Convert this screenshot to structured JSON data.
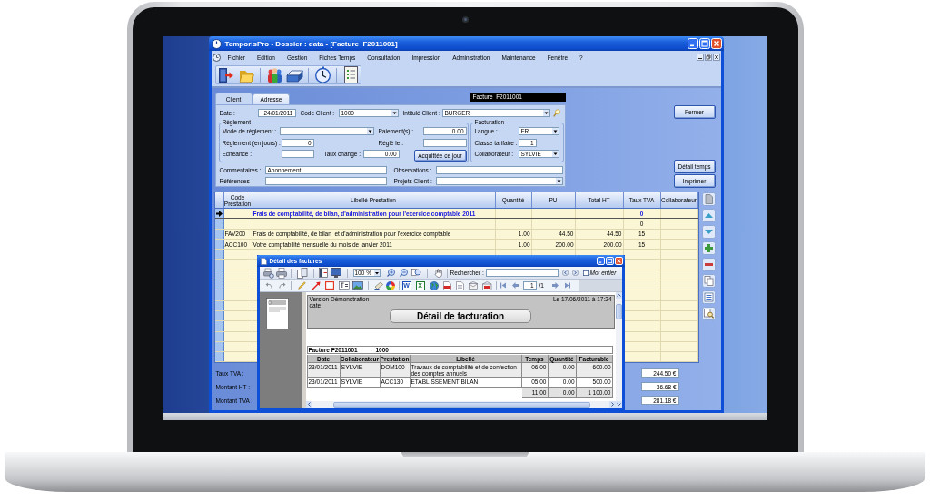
{
  "window": {
    "title": "TemporisPro - Dossier : data - [Facture  F2011001]"
  },
  "menu": [
    "Fichier",
    "Edition",
    "Gestion",
    "Fiches Temps",
    "Consultation",
    "Impression",
    "Administration",
    "Maintenance",
    "Fenêtre",
    "?"
  ],
  "tabs": [
    {
      "label": "Client",
      "selected": true
    },
    {
      "label": "Adresse",
      "selected": false
    }
  ],
  "document_label": "Facture  F2011001",
  "client": {
    "date": {
      "label": "Date :",
      "value": "24/01/2011"
    },
    "code": {
      "label": "Code Client :",
      "value": "1000"
    },
    "name": {
      "label": "Intitulé Client :",
      "value": "BURGER"
    }
  },
  "reglement": {
    "title": "Règlement",
    "mode": {
      "label": "Mode de règlement :"
    },
    "payments": {
      "label": "Paiement(s) :",
      "value": "0.00"
    },
    "days": {
      "label": "Règlement (en jours) :",
      "value": "0"
    },
    "paid_on": {
      "label": "Réglé le :"
    },
    "due_date": {
      "label": "Echéance :"
    },
    "exchange_rate": {
      "label": "Taux change :",
      "value": "0.00"
    },
    "button": "Acquittée ce jour"
  },
  "facturation": {
    "title": "Facturation",
    "language": {
      "label": "Langue :",
      "value": "FR"
    },
    "price_class": {
      "label": "Classe tarifaire :",
      "value": "1"
    },
    "staff": {
      "label": "Collaborateur :",
      "value": "SYLVIE"
    }
  },
  "notes": {
    "comments": {
      "label": "Commentaires :",
      "value": "Abonnement"
    },
    "observations": {
      "label": "Observations :"
    },
    "references": {
      "label": "Références :"
    },
    "projects": {
      "label": "Projets Client :"
    }
  },
  "buttons": [
    "Fermer",
    "Détail temps",
    "Imprimer"
  ],
  "table": {
    "columns": [
      "Code Prestation",
      "Libellé Prestation",
      "Quantité",
      "PU",
      "Total HT",
      "Taux TVA",
      "Collaborateur"
    ],
    "rows": [
      {
        "kind": "heading",
        "selected": true,
        "label": "Frais de comptabilité, de bilan, d'administration pour l'exercice comptable 2011",
        "vat": "0"
      },
      {
        "kind": "line",
        "selected": false,
        "vat": "0"
      },
      {
        "kind": "line",
        "selected": false,
        "code": "FAV200",
        "label": "Frais de comptabilité, de bilan  et d'administration pour l'exercice comptable",
        "quantity": "1.00",
        "unit_price": "44.50",
        "total": "44.50",
        "vat": "15"
      },
      {
        "kind": "line",
        "selected": false,
        "code": "ACC100",
        "label": "Votre comptabilité mensuelle du mois de janvier 2011",
        "quantity": "1.00",
        "unit_price": "200.00",
        "total": "200.00",
        "vat": "15"
      }
    ]
  },
  "totals": [
    {
      "label": "Taux TVA :",
      "value": "244.50 €"
    },
    {
      "label": "Montant HT :",
      "value": "36.68 €"
    },
    {
      "label": "Montant TVA :",
      "value": "281.18 €"
    }
  ],
  "report_window": {
    "title": "Détail des factures",
    "zoom": "100 %",
    "search_label": "Rechercher :",
    "whole_word": {
      "label": "Mot entier",
      "checked": false
    },
    "export": [
      {
        "label": "W",
        "color": "#1d4fb8"
      },
      {
        "label": "X",
        "color": "#1c7a2c"
      }
    ],
    "page": "1",
    "page_count": "/1",
    "report": {
      "version": "Version Démonstration",
      "date_label": "date",
      "printed_at": "Le 17/06/2011 à 17:24",
      "title": "Détail de facturation",
      "invoice": "Facture F2011001",
      "client_code": "1000",
      "columns": [
        "Date",
        "Collaborateur",
        "Prestation",
        "Libellé",
        "Temps",
        "Quantité",
        "Facturable"
      ],
      "rows": [
        [
          "23/01/2011",
          "SYLVIE",
          "DOM100",
          "Travaux de comptabilité et de confection des comptes annuels",
          "06:00",
          "0.00",
          "600.00"
        ],
        [
          "23/01/2011",
          "SYLVIE",
          "ACC130",
          "ETABLISSEMENT BILAN",
          "05:00",
          "0.00",
          "500.00"
        ]
      ],
      "totals": [
        "11:00",
        "0.00",
        "1 100.00"
      ]
    }
  }
}
